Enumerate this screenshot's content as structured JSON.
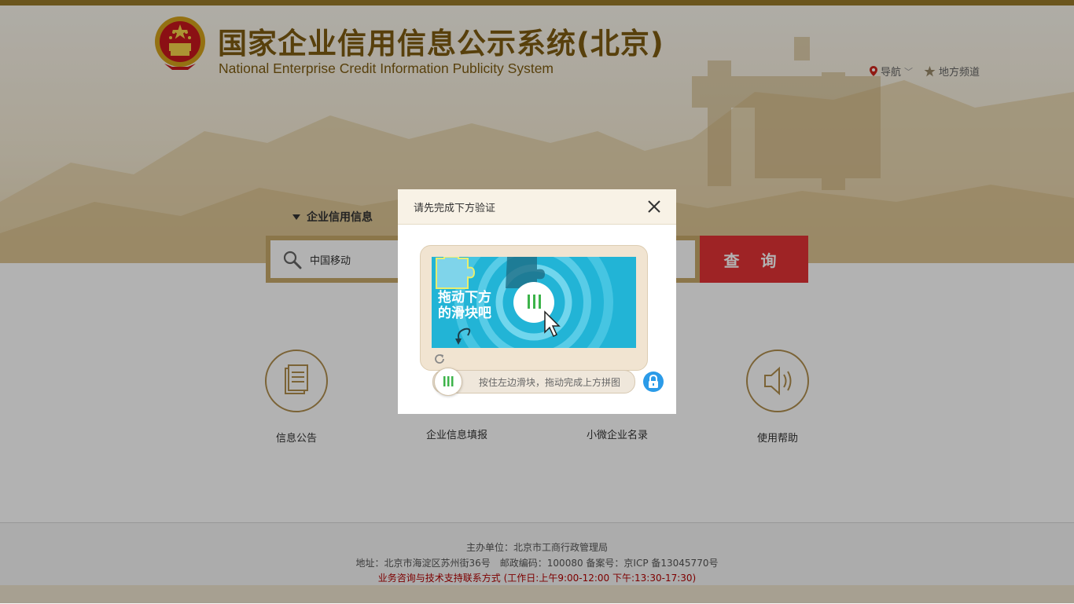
{
  "header": {
    "title_cn": "国家企业信用信息公示系统(北京)",
    "title_en": "National Enterprise Credit Information Publicity System",
    "nav_label": "导航",
    "channel_label": "地方频道"
  },
  "search": {
    "category": "企业信用信息",
    "value": "中国移动",
    "button_label": "查 询"
  },
  "features": [
    {
      "label": "信息公告",
      "icon": "document-icon"
    },
    {
      "label": "企业信息填报",
      "icon": "edit-icon"
    },
    {
      "label": "小微企业名录",
      "icon": "list-icon"
    },
    {
      "label": "使用帮助",
      "icon": "speaker-icon"
    }
  ],
  "footer": {
    "sponsor": "主办单位：北京市工商行政管理局",
    "address": "地址：北京市海淀区苏州街36号　邮政编码：100080 备案号：京ICP 备13045770号",
    "support": "业务咨询与技术支持联系方式 (工作日:上午9:00-12:00 下午:13:30-17:30)"
  },
  "modal": {
    "title": "请先完成下方验证",
    "captcha_text_line1": "拖动下方",
    "captcha_text_line2": "的滑块吧",
    "slider_hint": "按住左边滑块，拖动完成上方拼图"
  },
  "colors": {
    "brand_gold": "#7e5c12",
    "search_button": "#e23335",
    "captcha_bg": "#22b4d6",
    "lock_blue": "#2b9be8"
  }
}
